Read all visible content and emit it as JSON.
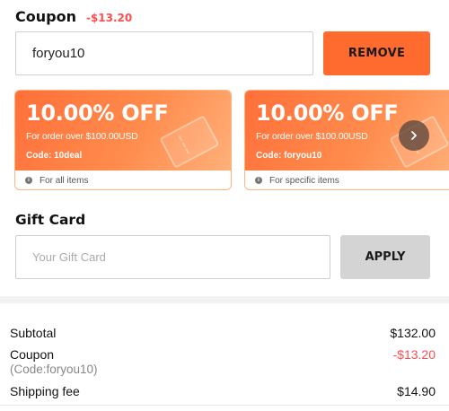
{
  "coupon": {
    "title": "Coupon",
    "discount": "-$13.20",
    "input_value": "foryou10",
    "remove_label": "REMOVE"
  },
  "coupon_cards": [
    {
      "amount": "10.00% OFF",
      "condition": "For order over $100.00USD",
      "code": "Code: 10deal",
      "scope": "For all items"
    },
    {
      "amount": "10.00% OFF",
      "condition": "For order over $100.00USD",
      "code": "Code: foryou10",
      "scope": "For specific items"
    }
  ],
  "gift_card": {
    "title": "Gift Card",
    "placeholder": "Your Gift Card",
    "apply_label": "APPLY"
  },
  "summary": {
    "subtotal_label": "Subtotal",
    "subtotal_value": "$132.00",
    "coupon_label": "Coupon",
    "coupon_value": "-$13.20",
    "coupon_code": "(Code:foryou10)",
    "shipping_label": "Shipping fee",
    "shipping_value": "$14.90"
  },
  "colors": {
    "accent": "#ff6a2f",
    "discount_red": "#ff4d4f",
    "apply_gray": "#d4d4d4"
  },
  "icons": {
    "info": "info-icon",
    "next": "chevron-right-icon",
    "ticket": "ticket-icon"
  }
}
